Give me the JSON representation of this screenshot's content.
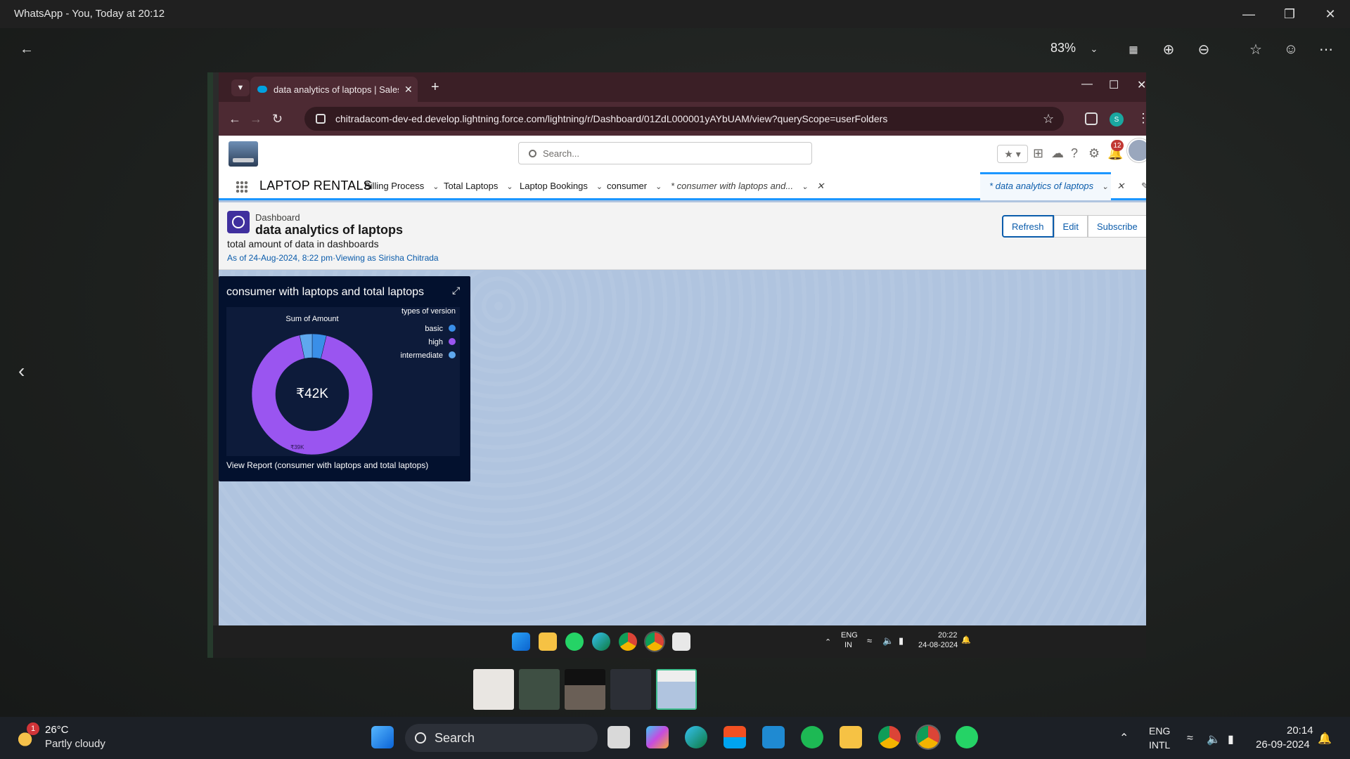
{
  "viewer": {
    "title": "WhatsApp - You, Today at 20:12",
    "zoom": "83%"
  },
  "browser": {
    "tab_title": "data analytics of laptops | Sales",
    "url": "chitradacom-dev-ed.develop.lightning.force.com/lightning/r/Dashboard/01ZdL000001yAYbUAM/view?queryScope=userFolders",
    "profile_initial": "S"
  },
  "sf": {
    "search_placeholder": "Search...",
    "notification_count": "12",
    "app_name": "LAPTOP RENTALS",
    "nav": {
      "billing": "Billing Process",
      "total_laptops": "Total Laptops",
      "laptop_bookings": "Laptop Bookings",
      "consumer": "consumer",
      "tab1": "* consumer with laptops and...",
      "tab2": "* data analytics of laptops"
    },
    "header": {
      "type_label": "Dashboard",
      "title": "data analytics of laptops",
      "description": "total amount of data in dashboards",
      "as_of": "As of 24-Aug-2024, 8:22 pm·Viewing as Sirisha Chitrada",
      "btn_refresh": "Refresh",
      "btn_edit": "Edit",
      "btn_subscribe": "Subscribe"
    },
    "widget": {
      "title": "consumer with laptops and total laptops",
      "link": "View Report (consumer with laptops and total laptops)"
    }
  },
  "chart_data": {
    "type": "donut",
    "title": "Sum of Amount",
    "total_label": "₹42K",
    "legend_title": "types of version",
    "legend_position": "top-right",
    "series": [
      {
        "name": "basic",
        "value": 1.6,
        "color": "#3a8fe8"
      },
      {
        "name": "high",
        "value": 39,
        "color": "#9a55f0",
        "label": "₹39K"
      },
      {
        "name": "intermediate",
        "value": 1.4,
        "color": "#5fa8ee"
      }
    ],
    "units": "K (thousands ₹, approximate)"
  },
  "inner_taskbar": {
    "lang": "ENG",
    "region": "IN",
    "time": "20:22",
    "date": "24-08-2024"
  },
  "taskbar": {
    "weather_temp": "26°C",
    "weather_desc": "Partly cloudy",
    "weather_badge": "1",
    "search": "Search",
    "lang": "ENG",
    "region": "INTL",
    "time": "20:14",
    "date": "26-09-2024"
  },
  "colors": {
    "sf_blue": "#0b5cab",
    "widget_bg": "#03112e",
    "canvas_bg": "#b0c4df"
  }
}
